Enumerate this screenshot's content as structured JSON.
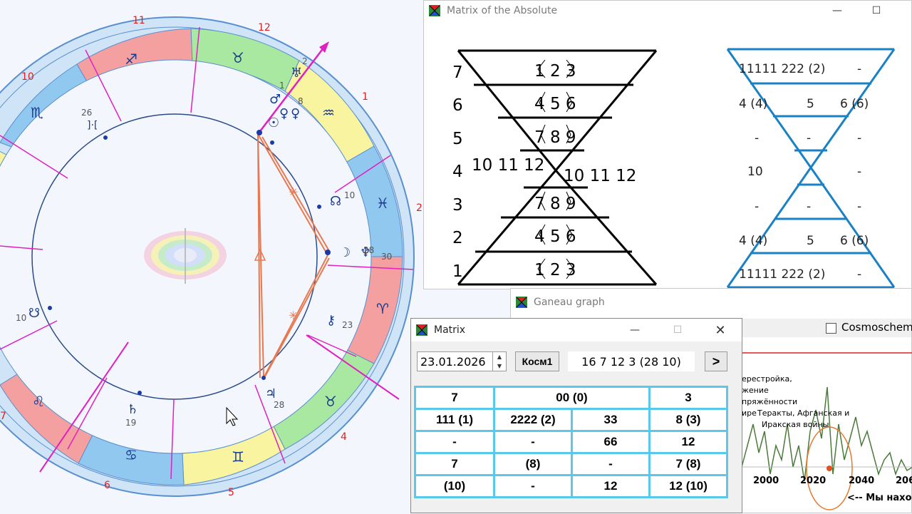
{
  "astro_chart": {
    "house_numbers": [
      "11",
      "12",
      "1",
      "2",
      "10",
      "7",
      "6",
      "5",
      "4"
    ],
    "planets": [
      "26",
      "10",
      "28",
      "30",
      "23",
      "28",
      "19",
      "10",
      "2",
      "1",
      "8"
    ],
    "symbol_labels": [
      "]·["
    ]
  },
  "matrix_absolute": {
    "title": "Matrix of the Absolute",
    "row_numbers": [
      "7",
      "6",
      "5",
      "4",
      "3",
      "2",
      "1"
    ],
    "left_labels": [
      "1 2 3",
      "4 5 6",
      "7 8 9",
      "10 11 12",
      "10 11 12",
      "7 8 9",
      "4 5 6",
      "1 2 3"
    ],
    "right_rows": [
      [
        "11111 222 (2)",
        "",
        "-"
      ],
      [
        "4 (4)",
        "5",
        "6 (6)"
      ],
      [
        "-",
        "-",
        "-"
      ],
      [
        "10",
        "",
        "-"
      ],
      [
        "-",
        "-",
        "-"
      ],
      [
        "4 (4)",
        "5",
        "6 (6)"
      ],
      [
        "11111 222 (2)",
        "",
        "-"
      ]
    ],
    "colors": {
      "left_line": "#000000",
      "right_line": "#1a82c4"
    }
  },
  "ganeau": {
    "title": "Ganeau graph",
    "cosmoscheme_label": "Cosmoscheme",
    "annotation_1": "ерестройка,\nжение\nпряжённости\nире",
    "annotation_2": "Теракты, Афганская и\nИракская войны",
    "axis_ticks": [
      "2000",
      "2020",
      "2040",
      "206"
    ],
    "we_are_here": "<-- Мы наход"
  },
  "matrix_window": {
    "title": "Matrix",
    "date_value": "23.01.2026",
    "kosm_button": "Косм1",
    "code": "16 7 12 3 (28 10)",
    "next_button": ">",
    "grid": [
      [
        "7",
        "00 (0)",
        "3"
      ],
      [
        "111 (1)",
        "2222 (2)",
        "33",
        "8 (3)"
      ],
      [
        "-",
        "-",
        "66",
        "12"
      ],
      [
        "7",
        "(8)",
        "-",
        "7 (8)"
      ],
      [
        "(10)",
        "-",
        "12",
        "12  (10)"
      ]
    ],
    "controls": {
      "minimize": "—",
      "maximize": "☐",
      "close": "✕"
    }
  },
  "colors": {
    "accent": "#5ac8ea",
    "pink": "#f5a0a0",
    "green": "#a8e8a0",
    "yellow": "#f8f4a0",
    "blue": "#90c8f0",
    "magenta": "#e020c0",
    "orange": "#e88060"
  }
}
